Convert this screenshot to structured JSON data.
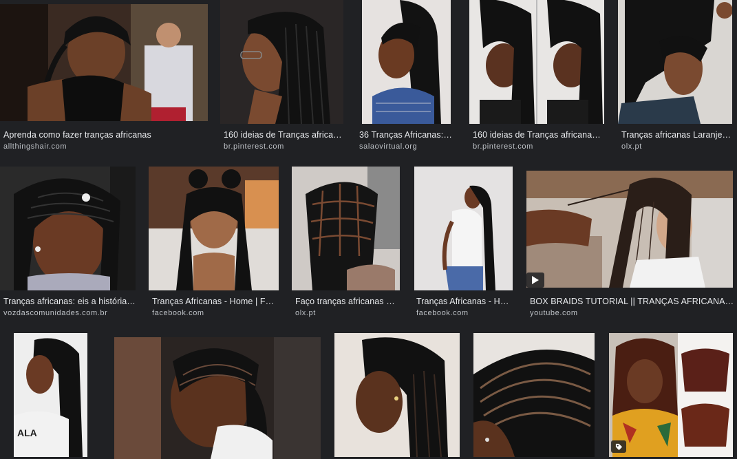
{
  "results": [
    {
      "title": "Aprenda como fazer tranças africanas",
      "source": "allthingshair.com"
    },
    {
      "title": "160 ideias de Tranças africa…",
      "source": "br.pinterest.com"
    },
    {
      "title": "36 Tranças Africanas: …",
      "source": "salaovirtual.org"
    },
    {
      "title": "160 ideias de Tranças africanas…",
      "source": "br.pinterest.com"
    },
    {
      "title": "Tranças africanas Laranje…",
      "source": "olx.pt"
    },
    {
      "title": "Tranças africanas: eis a história…",
      "source": "vozdascomunidades.com.br"
    },
    {
      "title": "Tranças Africanas - Home | Fa…",
      "source": "facebook.com"
    },
    {
      "title": "Faço tranças africanas …",
      "source": "olx.pt"
    },
    {
      "title": "Tranças Africanas - Ho…",
      "source": "facebook.com"
    },
    {
      "title": "BOX BRAIDS TUTORIAL || TRANÇAS AFRICANAS - Y…",
      "source": "youtube.com"
    }
  ],
  "icons": {
    "video": "play-icon",
    "product": "tag-icon"
  },
  "colors": {
    "background": "#202124",
    "title": "#e8eaed",
    "source": "#bdc1c6"
  }
}
